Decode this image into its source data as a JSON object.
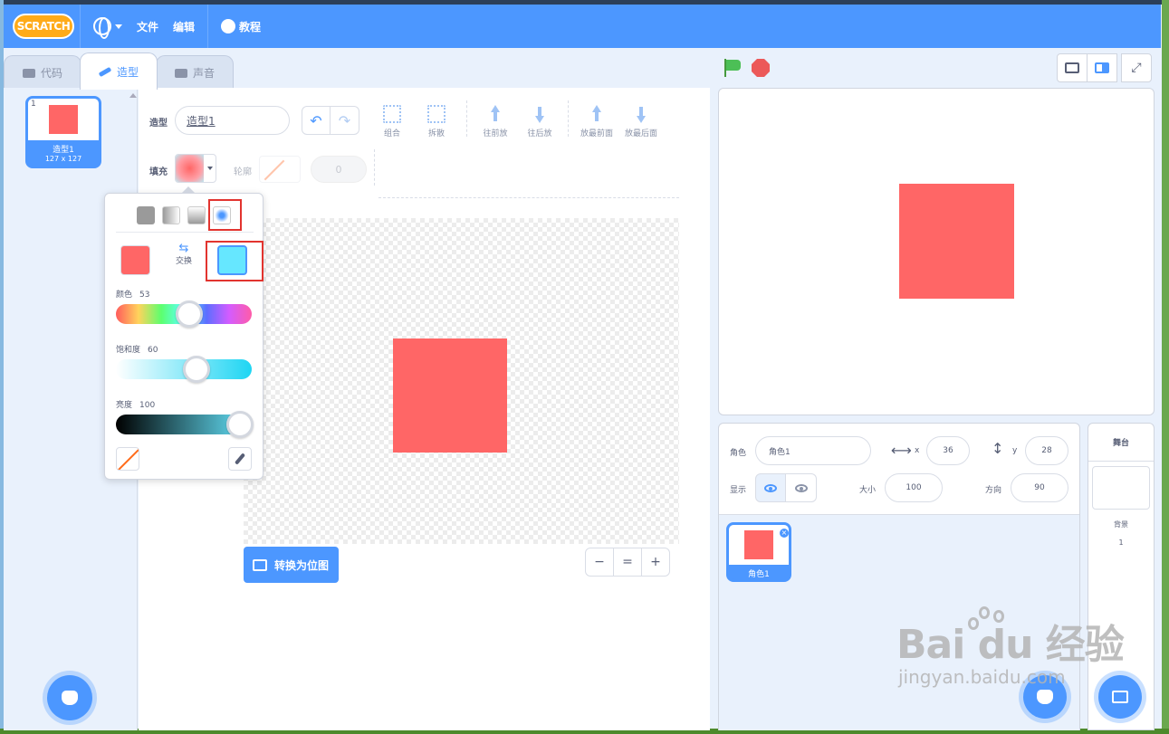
{
  "menubar": {
    "logo": "SCRATCH",
    "file": "文件",
    "edit": "编辑",
    "tutorials": "教程"
  },
  "tabs": [
    {
      "label": "代码",
      "active": false
    },
    {
      "label": "造型",
      "active": true
    },
    {
      "label": "声音",
      "active": false
    }
  ],
  "costume_list": {
    "items": [
      {
        "number": "1",
        "name": "造型1",
        "size": "127 x 127"
      }
    ]
  },
  "editor": {
    "costume_label": "造型",
    "costume_name": "造型1",
    "tools": {
      "group": "组合",
      "ungroup": "拆散",
      "forward": "往前放",
      "backward": "往后放",
      "front": "放最前面",
      "back": "放最后面"
    },
    "fill_label": "填充",
    "outline_label": "轮廓",
    "outline_width": "0",
    "convert_button": "转换为位图",
    "zoom": {
      "out": "−",
      "reset": "=",
      "in": "+"
    }
  },
  "color_picker": {
    "swap_label": "交换",
    "color_label": "颜色",
    "color_value": "53",
    "saturation_label": "饱和度",
    "saturation_value": "60",
    "brightness_label": "亮度",
    "brightness_value": "100",
    "color_fraction": 0.53,
    "saturation_fraction": 0.6,
    "brightness_fraction": 1.0,
    "swatch_primary": "#ff6666",
    "swatch_secondary": "#66e7ff"
  },
  "sprite_info": {
    "sprite_label": "角色",
    "sprite_name": "角色1",
    "x_label": "x",
    "x_value": "36",
    "y_label": "y",
    "y_value": "28",
    "show_label": "显示",
    "size_label": "大小",
    "size_value": "100",
    "direction_label": "方向",
    "direction_value": "90"
  },
  "sprites": [
    {
      "name": "角色1"
    }
  ],
  "stage_target": {
    "title": "舞台",
    "backdrops_label": "背景",
    "backdrops_count": "1"
  },
  "watermark": {
    "brand": "Bai  du 经验",
    "url": "jingyan.baidu.com"
  },
  "colors": {
    "accent": "#4c97ff",
    "shape": "#ff6666",
    "highlight": "#e2342f"
  }
}
